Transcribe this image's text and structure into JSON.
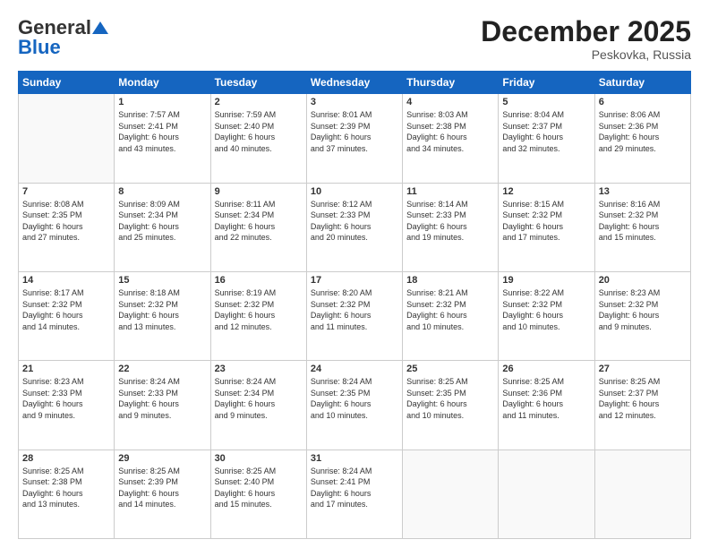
{
  "header": {
    "logo_line1": "General",
    "logo_line2": "Blue",
    "month": "December 2025",
    "location": "Peskovka, Russia"
  },
  "days": [
    "Sunday",
    "Monday",
    "Tuesday",
    "Wednesday",
    "Thursday",
    "Friday",
    "Saturday"
  ],
  "weeks": [
    [
      {
        "day": "",
        "content": ""
      },
      {
        "day": "1",
        "content": "Sunrise: 7:57 AM\nSunset: 2:41 PM\nDaylight: 6 hours\nand 43 minutes."
      },
      {
        "day": "2",
        "content": "Sunrise: 7:59 AM\nSunset: 2:40 PM\nDaylight: 6 hours\nand 40 minutes."
      },
      {
        "day": "3",
        "content": "Sunrise: 8:01 AM\nSunset: 2:39 PM\nDaylight: 6 hours\nand 37 minutes."
      },
      {
        "day": "4",
        "content": "Sunrise: 8:03 AM\nSunset: 2:38 PM\nDaylight: 6 hours\nand 34 minutes."
      },
      {
        "day": "5",
        "content": "Sunrise: 8:04 AM\nSunset: 2:37 PM\nDaylight: 6 hours\nand 32 minutes."
      },
      {
        "day": "6",
        "content": "Sunrise: 8:06 AM\nSunset: 2:36 PM\nDaylight: 6 hours\nand 29 minutes."
      }
    ],
    [
      {
        "day": "7",
        "content": "Sunrise: 8:08 AM\nSunset: 2:35 PM\nDaylight: 6 hours\nand 27 minutes."
      },
      {
        "day": "8",
        "content": "Sunrise: 8:09 AM\nSunset: 2:34 PM\nDaylight: 6 hours\nand 25 minutes."
      },
      {
        "day": "9",
        "content": "Sunrise: 8:11 AM\nSunset: 2:34 PM\nDaylight: 6 hours\nand 22 minutes."
      },
      {
        "day": "10",
        "content": "Sunrise: 8:12 AM\nSunset: 2:33 PM\nDaylight: 6 hours\nand 20 minutes."
      },
      {
        "day": "11",
        "content": "Sunrise: 8:14 AM\nSunset: 2:33 PM\nDaylight: 6 hours\nand 19 minutes."
      },
      {
        "day": "12",
        "content": "Sunrise: 8:15 AM\nSunset: 2:32 PM\nDaylight: 6 hours\nand 17 minutes."
      },
      {
        "day": "13",
        "content": "Sunrise: 8:16 AM\nSunset: 2:32 PM\nDaylight: 6 hours\nand 15 minutes."
      }
    ],
    [
      {
        "day": "14",
        "content": "Sunrise: 8:17 AM\nSunset: 2:32 PM\nDaylight: 6 hours\nand 14 minutes."
      },
      {
        "day": "15",
        "content": "Sunrise: 8:18 AM\nSunset: 2:32 PM\nDaylight: 6 hours\nand 13 minutes."
      },
      {
        "day": "16",
        "content": "Sunrise: 8:19 AM\nSunset: 2:32 PM\nDaylight: 6 hours\nand 12 minutes."
      },
      {
        "day": "17",
        "content": "Sunrise: 8:20 AM\nSunset: 2:32 PM\nDaylight: 6 hours\nand 11 minutes."
      },
      {
        "day": "18",
        "content": "Sunrise: 8:21 AM\nSunset: 2:32 PM\nDaylight: 6 hours\nand 10 minutes."
      },
      {
        "day": "19",
        "content": "Sunrise: 8:22 AM\nSunset: 2:32 PM\nDaylight: 6 hours\nand 10 minutes."
      },
      {
        "day": "20",
        "content": "Sunrise: 8:23 AM\nSunset: 2:32 PM\nDaylight: 6 hours\nand 9 minutes."
      }
    ],
    [
      {
        "day": "21",
        "content": "Sunrise: 8:23 AM\nSunset: 2:33 PM\nDaylight: 6 hours\nand 9 minutes."
      },
      {
        "day": "22",
        "content": "Sunrise: 8:24 AM\nSunset: 2:33 PM\nDaylight: 6 hours\nand 9 minutes."
      },
      {
        "day": "23",
        "content": "Sunrise: 8:24 AM\nSunset: 2:34 PM\nDaylight: 6 hours\nand 9 minutes."
      },
      {
        "day": "24",
        "content": "Sunrise: 8:24 AM\nSunset: 2:35 PM\nDaylight: 6 hours\nand 10 minutes."
      },
      {
        "day": "25",
        "content": "Sunrise: 8:25 AM\nSunset: 2:35 PM\nDaylight: 6 hours\nand 10 minutes."
      },
      {
        "day": "26",
        "content": "Sunrise: 8:25 AM\nSunset: 2:36 PM\nDaylight: 6 hours\nand 11 minutes."
      },
      {
        "day": "27",
        "content": "Sunrise: 8:25 AM\nSunset: 2:37 PM\nDaylight: 6 hours\nand 12 minutes."
      }
    ],
    [
      {
        "day": "28",
        "content": "Sunrise: 8:25 AM\nSunset: 2:38 PM\nDaylight: 6 hours\nand 13 minutes."
      },
      {
        "day": "29",
        "content": "Sunrise: 8:25 AM\nSunset: 2:39 PM\nDaylight: 6 hours\nand 14 minutes."
      },
      {
        "day": "30",
        "content": "Sunrise: 8:25 AM\nSunset: 2:40 PM\nDaylight: 6 hours\nand 15 minutes."
      },
      {
        "day": "31",
        "content": "Sunrise: 8:24 AM\nSunset: 2:41 PM\nDaylight: 6 hours\nand 17 minutes."
      },
      {
        "day": "",
        "content": ""
      },
      {
        "day": "",
        "content": ""
      },
      {
        "day": "",
        "content": ""
      }
    ]
  ]
}
